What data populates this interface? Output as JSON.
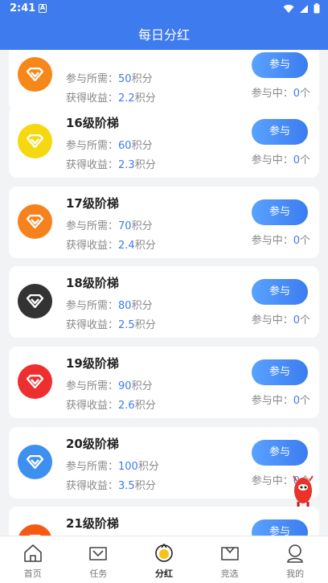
{
  "status_bar": {
    "time": "2:41"
  },
  "header": {
    "title": "每日分红"
  },
  "labels": {
    "req_prefix": "参与所需：",
    "req_suffix": "积分",
    "earn_prefix": "获得收益：",
    "earn_suffix": "积分",
    "join": "参与",
    "inprog_prefix": "参与中：",
    "inprog_suffix": "个"
  },
  "cards": [
    {
      "name": "",
      "req": "50",
      "earn": "2.2",
      "count": "0",
      "gem_color": "#f6881a"
    },
    {
      "name": "16级阶梯",
      "req": "60",
      "earn": "2.3",
      "count": "0",
      "gem_color": "#f5d80f"
    },
    {
      "name": "17级阶梯",
      "req": "70",
      "earn": "2.4",
      "count": "0",
      "gem_color": "#f6821d"
    },
    {
      "name": "18级阶梯",
      "req": "80",
      "earn": "2.5",
      "count": "0",
      "gem_color": "#333333"
    },
    {
      "name": "19级阶梯",
      "req": "90",
      "earn": "2.6",
      "count": "0",
      "gem_color": "#ee2f2f"
    },
    {
      "name": "20级阶梯",
      "req": "100",
      "earn": "3.5",
      "count": "0",
      "gem_color": "#3d8ff0"
    },
    {
      "name": "21级阶梯",
      "req": "",
      "earn": "",
      "count": "",
      "gem_color": "#f65a12"
    }
  ],
  "bottom_nav": [
    {
      "label": "首页",
      "icon": "home-icon"
    },
    {
      "label": "任务",
      "icon": "task-icon"
    },
    {
      "label": "分红",
      "icon": "dividend-icon",
      "active": true
    },
    {
      "label": "竞选",
      "icon": "campaign-icon"
    },
    {
      "label": "我的",
      "icon": "profile-icon"
    }
  ],
  "colors": {
    "primary": "#3e7bef",
    "background": "#f2f3f5"
  }
}
